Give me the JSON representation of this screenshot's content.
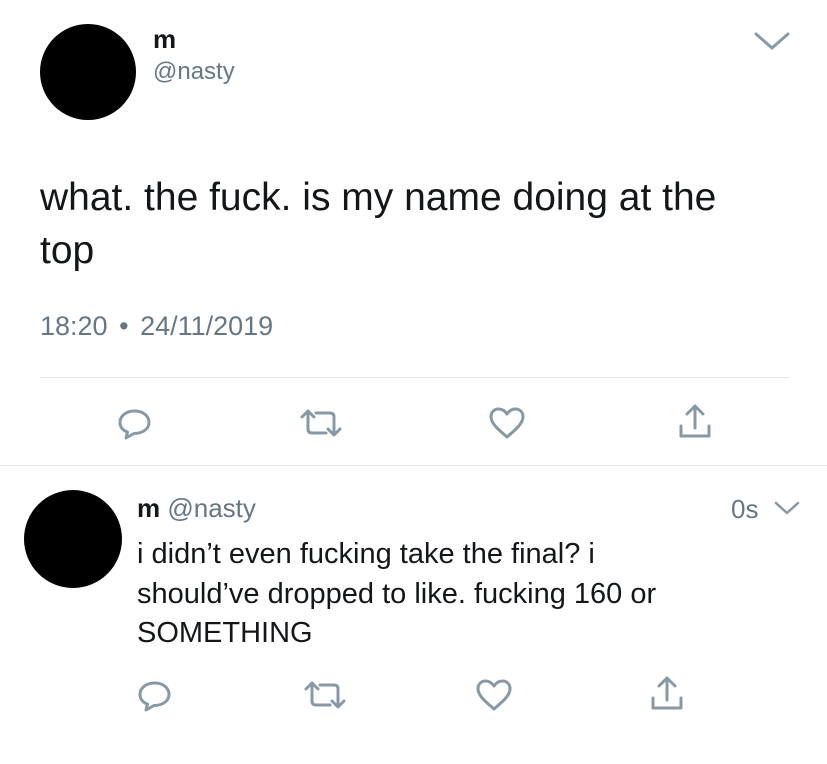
{
  "main_tweet": {
    "display_name": "m",
    "handle": "@nasty",
    "text_line1": "what. the fuck. is my name doing at the",
    "text_line2": "top",
    "time": "18:20",
    "separator": "•",
    "date": "24/11/2019"
  },
  "reply_tweet": {
    "display_name": "m",
    "handle": "@nasty",
    "age": "0s",
    "text_line1": "i didn’t even fucking take the final? i",
    "text_line2": "should’ve dropped to like. fucking 160 or",
    "text_line3": "SOMETHING"
  },
  "icons": {
    "reply": "reply-icon",
    "retweet": "retweet-icon",
    "like": "like-heart-icon",
    "share": "share-icon",
    "menu": "chevron-down-icon"
  },
  "colors": {
    "text": "#14171a",
    "muted": "#657786",
    "icon": "#8899a6",
    "divider": "#e1e8ed"
  }
}
